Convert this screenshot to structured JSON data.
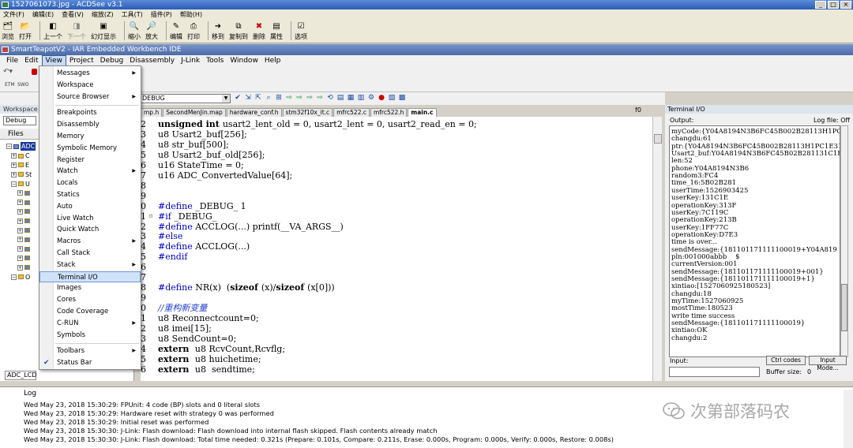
{
  "acdsee": {
    "title": "1527061073.jpg - ACDSee v3.1",
    "menu": [
      "文件(F)",
      "编辑(E)",
      "查看(V)",
      "缩放(Z)",
      "工具(T)",
      "插件(P)",
      "帮助(H)"
    ],
    "toolbar": [
      "浏览",
      "打开",
      "上一个",
      "下一个",
      "幻灯显示",
      "缩小",
      "放大",
      "编辑",
      "打印",
      "移到",
      "复制到",
      "删除",
      "属性",
      "选项"
    ]
  },
  "iar": {
    "title": "SmartTeapotV2 - IAR Embedded Workbench IDE",
    "menu": [
      "File",
      "Edit",
      "View",
      "Project",
      "Debug",
      "Disassembly",
      "J-Link",
      "Tools",
      "Window",
      "Help"
    ],
    "config_combo": "DEBUG",
    "toolbar_labels": [
      "ETM",
      "SWO"
    ]
  },
  "workspace": {
    "header": "Workspace",
    "config": "Debug",
    "files_label": "Files",
    "tree": [
      "ADC",
      "C",
      "E",
      "St",
      "U",
      "",
      "",
      "",
      "",
      "",
      "",
      "",
      "",
      "",
      "O"
    ],
    "bottom_tab": "ADC_LCD"
  },
  "view_menu": {
    "items": [
      {
        "label": "Messages",
        "sub": true
      },
      {
        "label": "Workspace"
      },
      {
        "label": "Source Browser",
        "sub": true
      },
      {
        "sep": true
      },
      {
        "label": "Breakpoints"
      },
      {
        "label": "Disassembly"
      },
      {
        "label": "Memory"
      },
      {
        "label": "Symbolic Memory"
      },
      {
        "label": "Register"
      },
      {
        "label": "Watch",
        "sub": true
      },
      {
        "label": "Locals"
      },
      {
        "label": "Statics"
      },
      {
        "label": "Auto"
      },
      {
        "label": "Live Watch"
      },
      {
        "label": "Quick Watch"
      },
      {
        "label": "Macros",
        "sub": true
      },
      {
        "label": "Call Stack"
      },
      {
        "label": "Stack",
        "sub": true
      },
      {
        "label": "Terminal I/O",
        "highlighted": true
      },
      {
        "label": "Images"
      },
      {
        "label": "Cores"
      },
      {
        "label": "Code Coverage"
      },
      {
        "label": "C-RUN",
        "sub": true
      },
      {
        "label": "Symbols"
      },
      {
        "sep": true
      },
      {
        "label": "Toolbars",
        "sub": true
      },
      {
        "label": "Status Bar",
        "checked": true
      }
    ]
  },
  "editor": {
    "tabs": [
      "mp.h",
      "SecondMenJin.map",
      "hardware_conf.h",
      "stm32f10x_it.c",
      "mfrc522.c",
      "mfrc522.h",
      "main.c"
    ],
    "active_tab": "main.c",
    "function_label": "f0",
    "lines": [
      {
        "n": "2",
        "segs": [
          [
            "kw",
            "unsigned int"
          ],
          [
            "",
            "usart2_lent_old = 0, usart2_lent = 0, usart2_read_en = 0;"
          ]
        ]
      },
      {
        "n": "3",
        "segs": [
          [
            "",
            "u8 Usart2_buf[256];"
          ]
        ]
      },
      {
        "n": "4",
        "segs": [
          [
            "",
            "u8 str_buf[500];"
          ]
        ]
      },
      {
        "n": "5",
        "segs": [
          [
            "",
            "u8 Usart2_buf_old[256];"
          ]
        ]
      },
      {
        "n": "6",
        "segs": [
          [
            "",
            "u16 StateTime = 0;"
          ]
        ]
      },
      {
        "n": "7",
        "segs": [
          [
            "",
            "u16 ADC_ConvertedValue[64];"
          ]
        ]
      },
      {
        "n": "8",
        "segs": []
      },
      {
        "n": "9",
        "segs": []
      },
      {
        "n": "0",
        "segs": [
          [
            "pp",
            "#define"
          ],
          [
            "",
            " _DEBUG_ 1"
          ]
        ]
      },
      {
        "n": "1",
        "fold": true,
        "segs": [
          [
            "pp",
            "#if"
          ],
          [
            "",
            " _DEBUG_"
          ]
        ]
      },
      {
        "n": "2",
        "segs": [
          [
            "pp",
            "#define"
          ],
          [
            "",
            " ACCLOG(...) printf(__VA_ARGS__)"
          ]
        ]
      },
      {
        "n": "3",
        "segs": [
          [
            "pp",
            "#else"
          ]
        ]
      },
      {
        "n": "4",
        "segs": [
          [
            "pp",
            "#define"
          ],
          [
            "",
            " ACCLOG(...)"
          ]
        ]
      },
      {
        "n": "5",
        "segs": [
          [
            "pp",
            "#endif"
          ]
        ]
      },
      {
        "n": "6",
        "segs": []
      },
      {
        "n": "7",
        "segs": []
      },
      {
        "n": "8",
        "segs": [
          [
            "pp",
            "#define"
          ],
          [
            "",
            " NR(x)  ("
          ],
          [
            "kw",
            "sizeof"
          ],
          [
            "",
            "(x)/"
          ],
          [
            "kw",
            "sizeof"
          ],
          [
            "",
            "(x[0]))"
          ]
        ]
      },
      {
        "n": "9",
        "segs": []
      },
      {
        "n": "0",
        "segs": [
          [
            "cm",
            "//重构新变量"
          ]
        ]
      },
      {
        "n": "1",
        "segs": [
          [
            "",
            "u8 Reconnectcount=0;"
          ]
        ]
      },
      {
        "n": "2",
        "segs": [
          [
            "",
            "u8 imei[15];"
          ]
        ]
      },
      {
        "n": "3",
        "segs": [
          [
            "",
            "u8 SendCount=0;"
          ]
        ]
      },
      {
        "n": "4",
        "segs": [
          [
            "kw",
            "extern"
          ],
          [
            "",
            " u8 RcvCount,Rcvflg;"
          ]
        ]
      },
      {
        "n": "5",
        "segs": [
          [
            "kw",
            "extern"
          ],
          [
            "",
            " u8 huichetime;"
          ]
        ]
      },
      {
        "n": "6",
        "segs": [
          [
            "kw",
            "extern"
          ],
          [
            "",
            " u8  sendtime;"
          ]
        ]
      }
    ]
  },
  "terminal": {
    "header": "Terminal I/O",
    "output_label": "Output:",
    "log_file_label": "Log file: Off",
    "lines": [
      "myCode:{Y04A8194N3B6FC45B002B28113H1PC1",
      "changdu:61",
      "ptr:{Y04A8194N3B6FC45B002B28113H1PC1E31",
      "Usart2_buf:Y04A8194N3B6FC45B02B281131C1E",
      "len:52",
      "phone:Y04A8194N3B6",
      "random3:FC4",
      "time_16:5B02B281",
      "userTime:1526903425",
      "userKey:131C1E",
      "operationKey:313F",
      "userKey:7C119C",
      "operationKey:213B",
      "userKey:1FF77C",
      "operationKey:D7E3",
      "time is over...",
      "sendMessage:{181101171111100019+Y04A819",
      "pln:001000abbb    $",
      "currentVersion:001",
      "sendMessage:{181101171111100019+001}",
      "sendMessage:{181101171111100019+1}",
      "xintiao:[1527060925180523]",
      "changdu:18",
      "myTime:1527060925",
      "mostTime:180523",
      "write time success",
      "sendMessage:{181101171111100019}",
      "xintiao:OK",
      "changdu:2"
    ],
    "input_label": "Input:",
    "ctrl_codes_button": "Ctrl codes",
    "input_mode_button": "Input Mode...",
    "buffer_size_label": "Buffer size:",
    "buffer_size_value": "0"
  },
  "log": {
    "header": "Log",
    "lines": [
      "Wed May 23, 2018 15:30:29: FPUnit: 4 code (BP) slots and 0 literal slots",
      "Wed May 23, 2018 15:30:29: Hardware reset with strategy 0 was performed",
      "Wed May 23, 2018 15:30:29: Initial reset was performed",
      "Wed May 23, 2018 15:30:30: J-Link: Flash download: Flash download into internal flash skipped. Flash contents already match",
      "Wed May 23, 2018 15:30:30: J-Link: Flash download: Total time needed: 0.321s (Prepare: 0.101s, Compare: 0.211s, Erase: 0.000s, Program: 0.000s, Verify: 0.000s, Restore: 0.008s)"
    ]
  },
  "watermark": "次第部落码农"
}
